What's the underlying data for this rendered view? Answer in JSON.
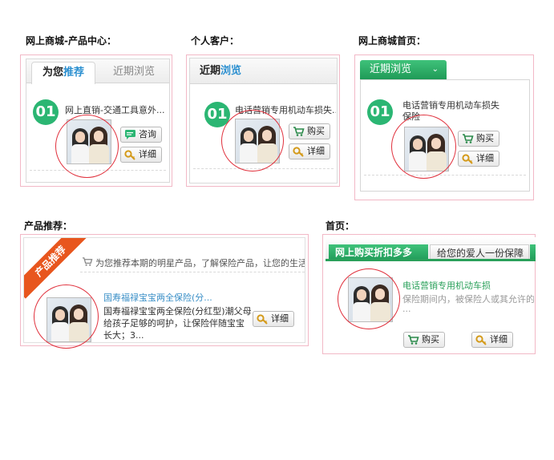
{
  "labels": {
    "mall_center": "网上商城-产品中心：",
    "personal": "个人客户：",
    "mall_home": "网上商城首页：",
    "recommend": "产品推荐：",
    "home": "首页："
  },
  "panel1": {
    "tab_active_plain": "为您",
    "tab_active_highlight": "推荐",
    "tab_inactive": "近期浏览",
    "number": "01",
    "title": "网上直销-交通工具意外...",
    "btn_consult": "咨询",
    "btn_detail": "详细"
  },
  "panel2": {
    "tab_plain": "近期",
    "tab_highlight": "浏览",
    "number": "01",
    "title": "电话营销专用机动车损失...",
    "btn_buy": "购买",
    "btn_detail": "详细"
  },
  "panel3": {
    "tab": "近期浏览",
    "number": "01",
    "title_line1": "电话营销专用机动车损失",
    "title_line2": "保险",
    "btn_buy": "购买",
    "btn_detail": "详细"
  },
  "panel4": {
    "ribbon": "产品推荐",
    "notice": "为您推荐本期的明星产品，了解保险产品，让您的生活快",
    "title": "国寿福禄宝宝两全保险(分...",
    "desc_line1": "国寿福禄宝宝两全保险(分红型)潮父母",
    "desc_line2": "给孩子足够的呵护，让保险伴随宝宝",
    "desc_line3": "长大；3...",
    "btn_detail": "详细"
  },
  "panel5": {
    "tab_active": "网上购买折扣多多",
    "tab_second": "给您的爱人一份保障",
    "title": "电话营销专用机动车损",
    "desc_line1": "保险期间内，被保险人或其允许的",
    "desc_line2": "...",
    "btn_buy": "购买",
    "btn_detail": "详细"
  },
  "colors": {
    "accent_green": "#2bb673",
    "highlight_blue": "#2b8fd0",
    "annotation_red": "#e0303c",
    "frame_pink": "#f2b8c6",
    "ribbon_orange": "#e8561e"
  }
}
